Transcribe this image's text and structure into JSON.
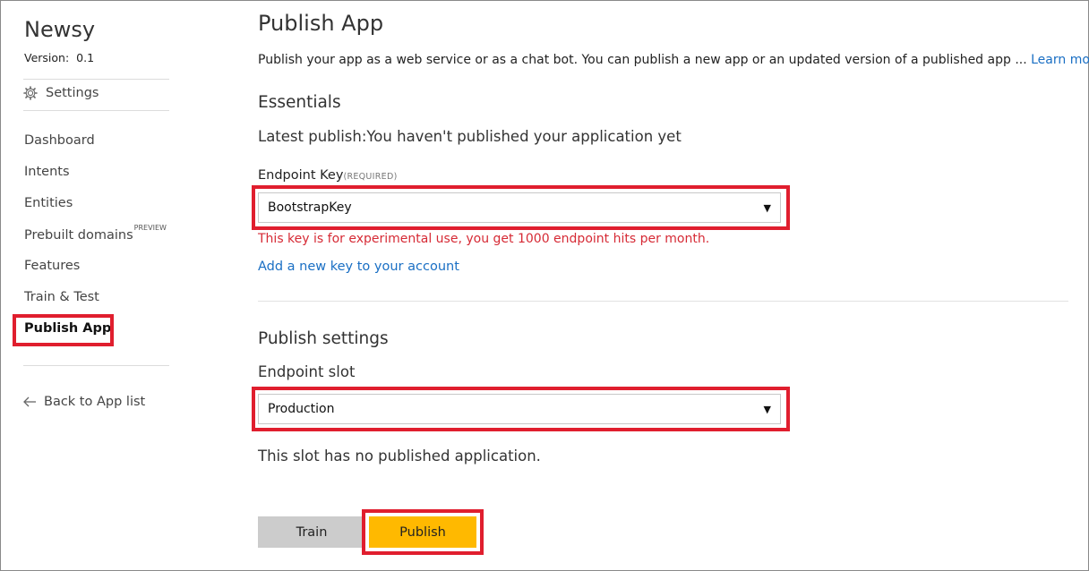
{
  "sidebar": {
    "app_name": "Newsy",
    "version_label": "Version:",
    "version_value": "0.1",
    "settings_label": "Settings",
    "items": [
      {
        "label": "Dashboard"
      },
      {
        "label": "Intents"
      },
      {
        "label": "Entities"
      },
      {
        "label": "Prebuilt domains",
        "badge": "PREVIEW"
      },
      {
        "label": "Features"
      },
      {
        "label": "Train & Test"
      },
      {
        "label": "Publish App",
        "active": true
      }
    ],
    "back_label": "Back to App list"
  },
  "main": {
    "title": "Publish App",
    "description": "Publish your app as a web service or as a chat bot. You can publish a new app or an updated version of a published app ...",
    "learn_more": "Learn more",
    "essentials_heading": "Essentials",
    "latest_publish": "Latest publish:You haven't published your application yet",
    "endpoint_key_label": "Endpoint Key",
    "endpoint_key_required": "(REQUIRED)",
    "endpoint_key_value": "BootstrapKey",
    "endpoint_key_warning": "This key is for experimental use, you get 1000 endpoint hits per month.",
    "add_key_link": "Add a new key to your account",
    "publish_settings_heading": "Publish settings",
    "endpoint_slot_label": "Endpoint slot",
    "endpoint_slot_value": "Production",
    "slot_status": "This slot has no published application.",
    "train_button": "Train",
    "publish_button": "Publish"
  },
  "colors": {
    "highlight": "#e01e2e",
    "publish_button": "#ffb900",
    "train_button": "#cccccc",
    "link": "#1a6fc4",
    "warning": "#d62a35"
  }
}
